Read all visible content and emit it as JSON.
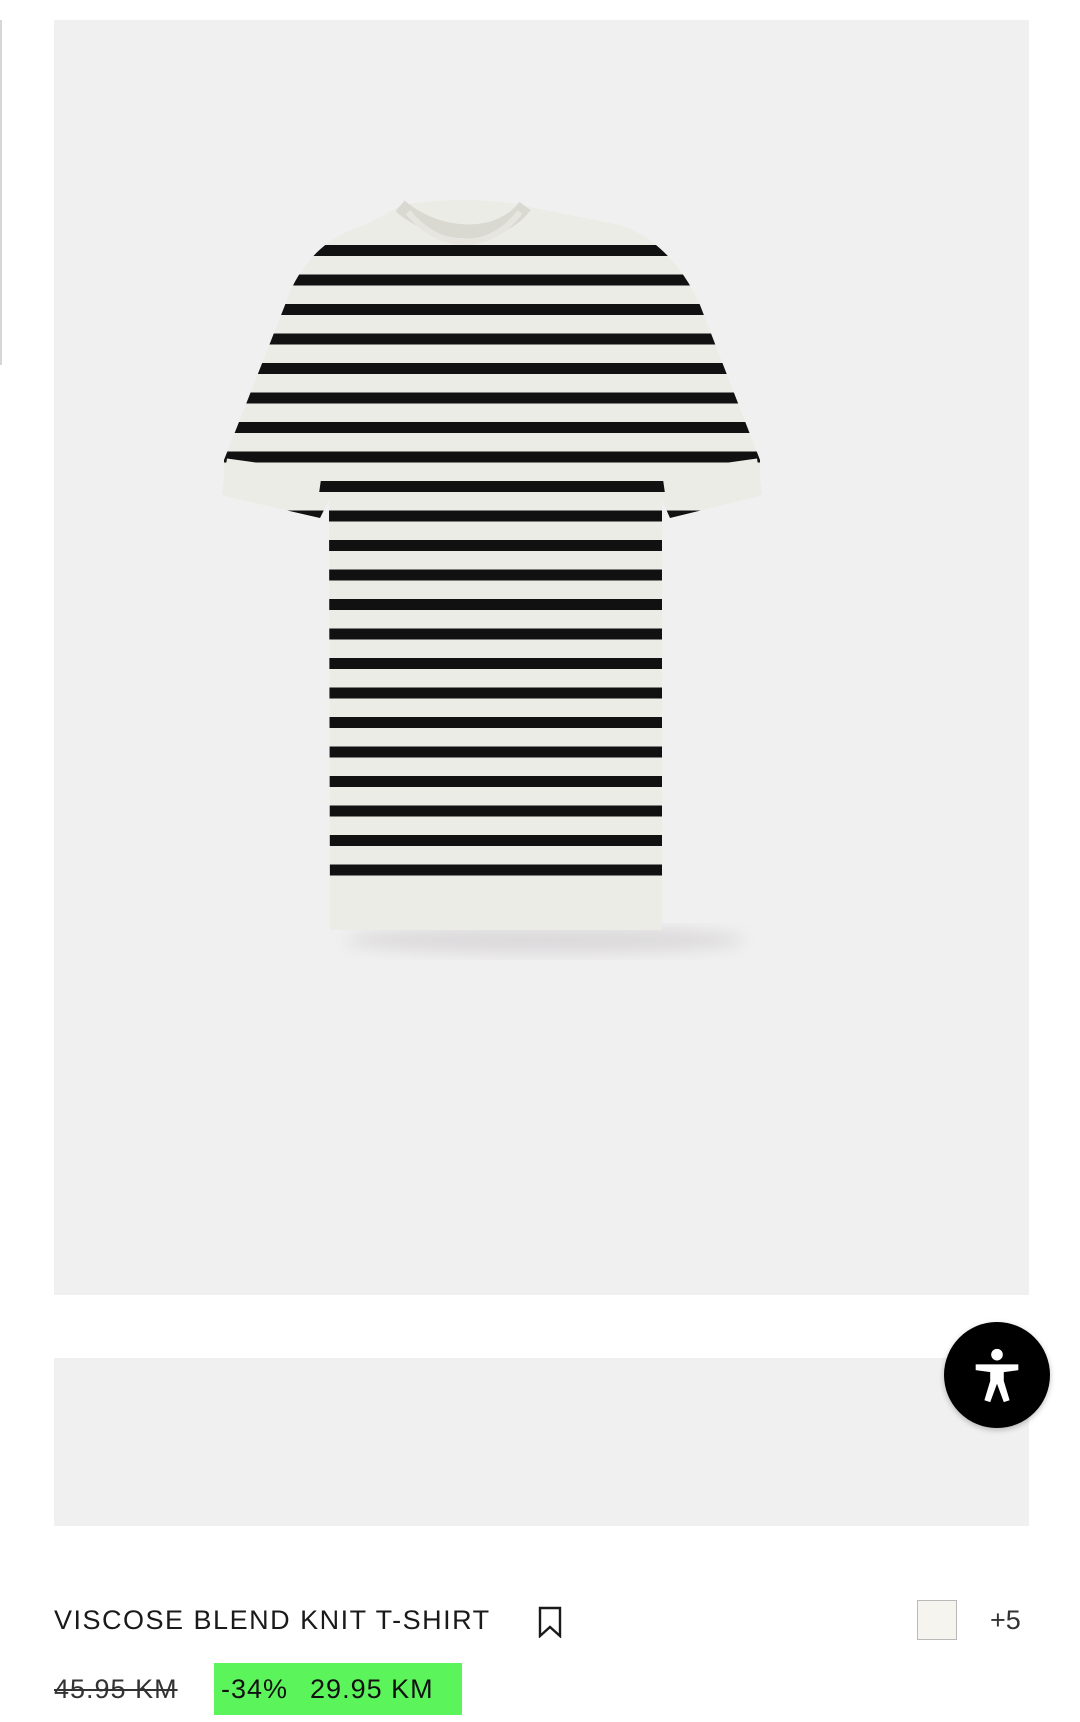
{
  "product": {
    "title": "VISCOSE BLEND KNIT T-SHIRT",
    "image_alt": "Striped knit t-shirt",
    "colors": {
      "swatch": "#f6f4ee",
      "more_label": "+5"
    },
    "price": {
      "original": "45.95 KM",
      "discount": "-34%",
      "current": "29.95 KM",
      "sale_color": "#5bf55b"
    }
  },
  "icons": {
    "bookmark": "bookmark-icon",
    "accessibility": "accessibility-icon"
  }
}
